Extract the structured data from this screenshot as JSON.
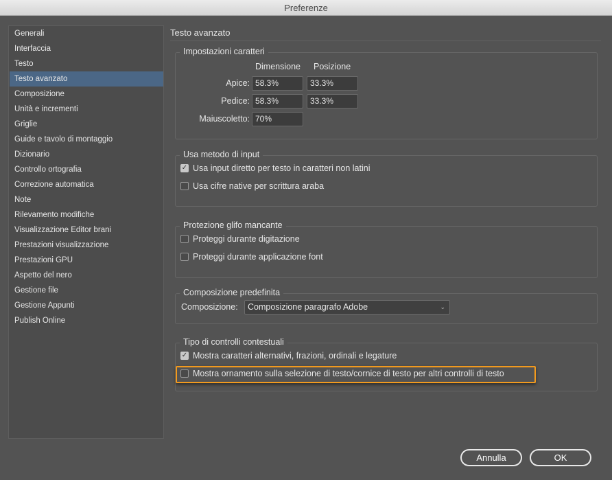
{
  "window": {
    "title": "Preferenze"
  },
  "sidebar": {
    "items": [
      "Generali",
      "Interfaccia",
      "Testo",
      "Testo avanzato",
      "Composizione",
      "Unità e incrementi",
      "Griglie",
      "Guide e tavolo di montaggio",
      "Dizionario",
      "Controllo ortografia",
      "Correzione automatica",
      "Note",
      "Rilevamento modifiche",
      "Visualizzazione Editor brani",
      "Prestazioni visualizzazione",
      "Prestazioni GPU",
      "Aspetto del nero",
      "Gestione file",
      "Gestione Appunti",
      "Publish Online"
    ],
    "selected": "Testo avanzato"
  },
  "main": {
    "heading": "Testo avanzato",
    "char_settings": {
      "label": "Impostazioni caratteri",
      "col_size": "Dimensione",
      "col_pos": "Posizione",
      "apice_label": "Apice:",
      "apice_size": "58.3%",
      "apice_pos": "33.3%",
      "pedice_label": "Pedice:",
      "pedice_size": "58.3%",
      "pedice_pos": "33.3%",
      "maiusc_label": "Maiuscoletto:",
      "maiusc_size": "70%"
    },
    "input_method": {
      "label": "Usa metodo di input",
      "opt1": "Usa input diretto per testo in caratteri non latini",
      "opt1_checked": true,
      "opt2": "Usa cifre native per scrittura araba",
      "opt2_checked": false
    },
    "glyph": {
      "label": "Protezione glifo mancante",
      "opt1": "Proteggi durante digitazione",
      "opt1_checked": false,
      "opt2": "Proteggi durante applicazione font",
      "opt2_checked": false
    },
    "composer": {
      "label": "Composizione predefinita",
      "field_label": "Composizione:",
      "value": "Composizione paragrafo Adobe"
    },
    "contextual": {
      "label": "Tipo di controlli contestuali",
      "opt1": "Mostra caratteri alternativi, frazioni, ordinali e legature",
      "opt1_checked": true,
      "opt2": "Mostra ornamento sulla selezione di testo/cornice di testo per altri controlli di testo",
      "opt2_checked": false
    }
  },
  "buttons": {
    "cancel": "Annulla",
    "ok": "OK"
  },
  "colors": {
    "highlight": "#f29a1e",
    "selected": "#4b6786"
  }
}
